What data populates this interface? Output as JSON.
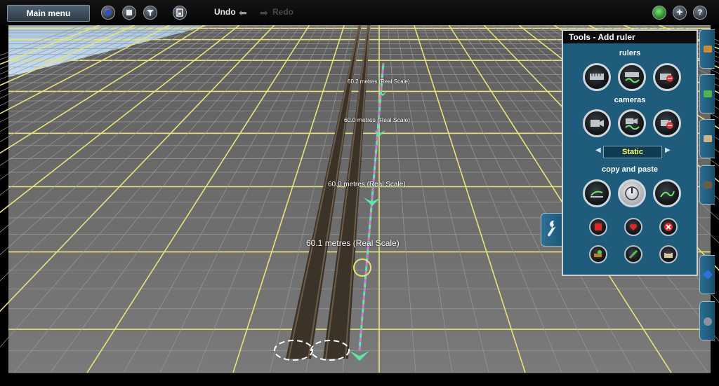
{
  "toolbar": {
    "main_menu": "Main menu",
    "undo": "Undo",
    "redo": "Redo",
    "icons": [
      "driver-icon",
      "stop-icon",
      "filter-icon",
      "save-icon",
      "undo-arrow-icon",
      "redo-arrow-icon",
      "status-light-icon",
      "add-icon",
      "help-icon"
    ]
  },
  "tools_panel": {
    "title": "Tools - Add ruler",
    "sections": {
      "rulers": "rulers",
      "cameras": "cameras",
      "copy_paste": "copy and paste"
    },
    "camera_mode": "Static",
    "icons": {
      "rulers": [
        "add-ruler-icon",
        "ruler-wave-icon",
        "delete-ruler-icon"
      ],
      "cameras": [
        "add-camera-icon",
        "camera-track-icon",
        "delete-camera-icon"
      ],
      "copy_paste": [
        "copy-icon",
        "rotate-dial-icon",
        "paste-icon"
      ],
      "small_row_1": [
        "stop-square-icon",
        "heart-icon",
        "cross-icon"
      ],
      "small_row_2": [
        "loco-paint-icon",
        "track-paint-icon",
        "coal-icon"
      ]
    }
  },
  "ruler_labels": [
    "60.2 metres (Real Scale)",
    "60.0 metres (Real Scale)",
    "60.0 metres (Real Scale)",
    "60.1 metres (Real Scale)"
  ],
  "colors": {
    "panel_bg": "#1f5c7c",
    "grid_major": "#e9e27a",
    "ground": "#6f6f6f",
    "sky": "#bcd6ee",
    "ruler_green": "#5fe6a5",
    "ruler_magenta": "#d277d8",
    "selector_text": "#ffff66"
  }
}
